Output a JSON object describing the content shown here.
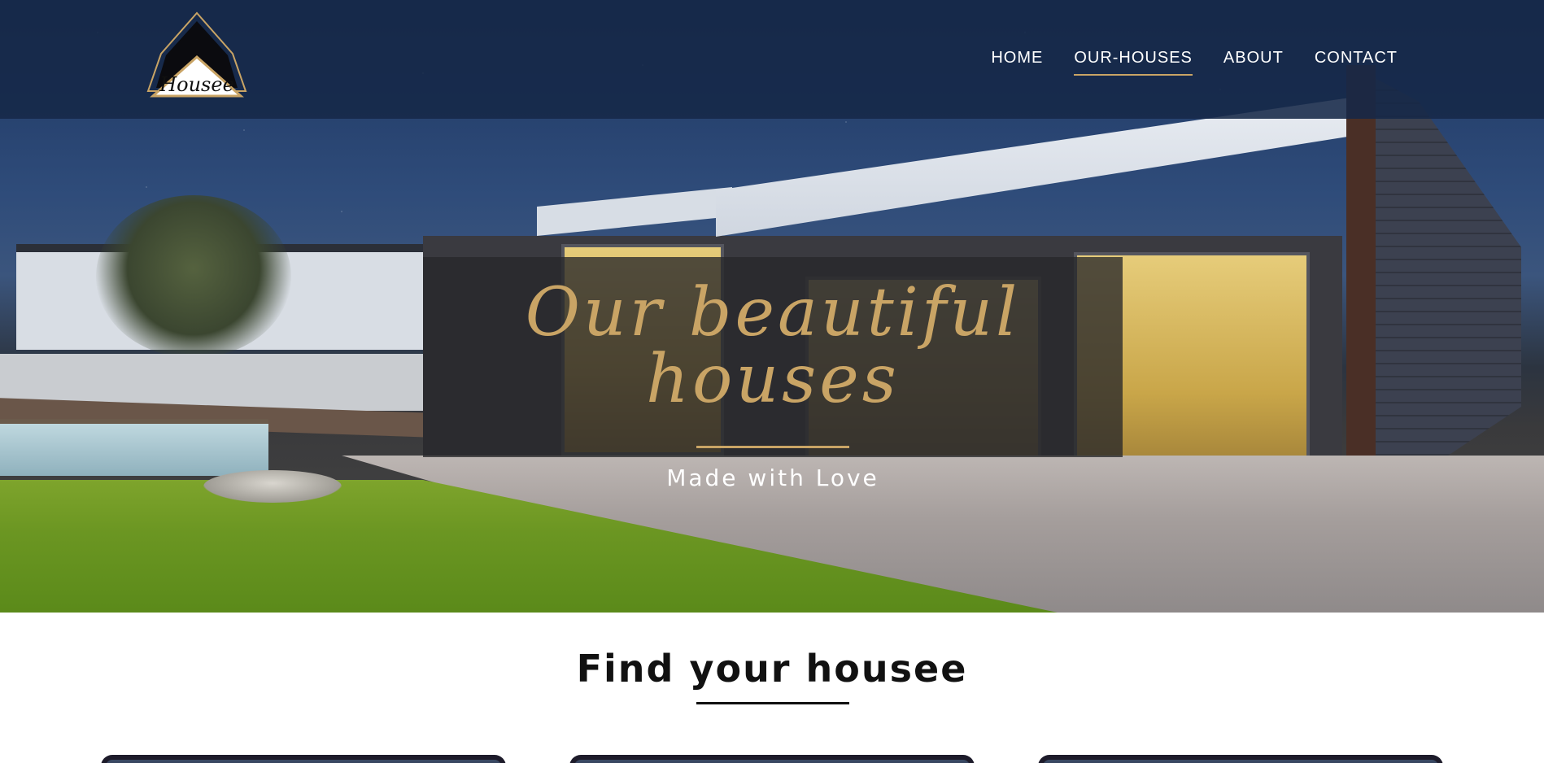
{
  "logo": {
    "text": "Housee"
  },
  "nav": {
    "items": [
      {
        "label": "HOME",
        "active": false
      },
      {
        "label": "OUR-HOUSES",
        "active": true
      },
      {
        "label": "ABOUT",
        "active": false
      },
      {
        "label": "CONTACT",
        "active": false
      }
    ]
  },
  "hero": {
    "title": "Our beautiful houses",
    "subtitle": "Made with Love"
  },
  "find": {
    "title": "Find your housee"
  },
  "colors": {
    "accent": "#c9a465",
    "navbar": "#162848",
    "dark": "#1d1b2a"
  }
}
